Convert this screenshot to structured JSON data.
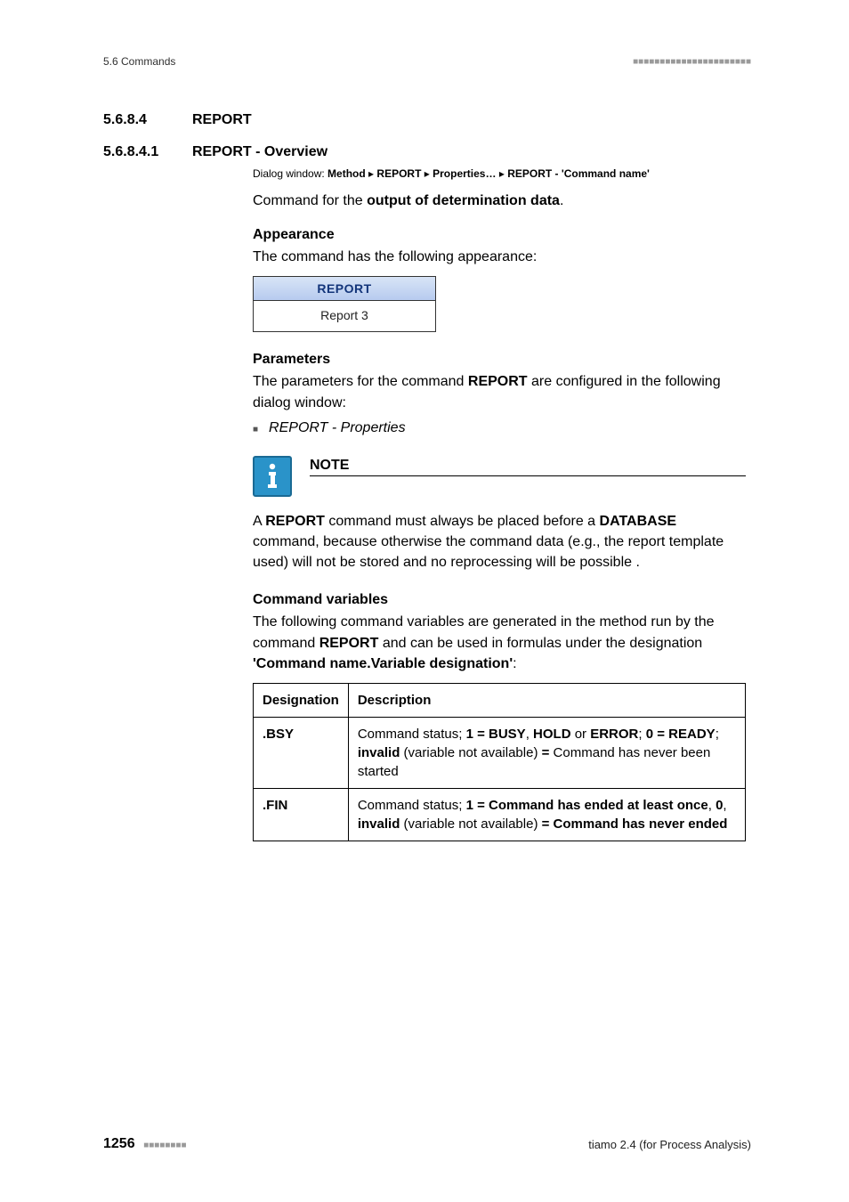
{
  "header": {
    "left": "5.6 Commands",
    "right_dashes": "■■■■■■■■■■■■■■■■■■■■■■"
  },
  "section1": {
    "num": "5.6.8.4",
    "title": "REPORT"
  },
  "section2": {
    "num": "5.6.8.4.1",
    "title": "REPORT - Overview"
  },
  "dialog": {
    "prefix": "Dialog window: ",
    "p1": "Method",
    "sep": " ▸ ",
    "p2": "REPORT",
    "p3": "Properties…",
    "p4": "REPORT - 'Command name'"
  },
  "intro": {
    "pre": "Command for the ",
    "bold": "output of determination data",
    "post": "."
  },
  "appearance": {
    "heading": "Appearance",
    "text": "The command has the following appearance:",
    "card_title": "REPORT",
    "card_body": "Report 3"
  },
  "parameters": {
    "heading": "Parameters",
    "text_pre": "The parameters for the command ",
    "text_bold": "REPORT",
    "text_post": " are configured in the following dialog window:",
    "item": "REPORT - Properties"
  },
  "note": {
    "title": "NOTE",
    "t1": "A ",
    "b1": "REPORT",
    "t2": " command must always be placed before a ",
    "b2": "DATABASE",
    "t3": " command, because otherwise the command data (e.g., the report template used) will not be stored and no reprocessing will be possible ."
  },
  "cmdvars": {
    "heading": "Command variables",
    "t1": "The following command variables are generated in the method run by the command ",
    "b1": "REPORT",
    "t2": " and can be used in formulas under the designation ",
    "b2": "'Command name.Variable designation'",
    "t3": ":"
  },
  "table": {
    "h1": "Designation",
    "h2": "Description",
    "rows": [
      {
        "d": ".BSY",
        "parts": {
          "a": "Command status; ",
          "b1": "1 = BUSY",
          "c1": ", ",
          "b2": "HOLD",
          "c2": " or ",
          "b3": "ERROR",
          "c3": "; ",
          "b4": "0 = READY",
          "c4": "; ",
          "b5": "invalid",
          "c5": " (variable not available) ",
          "b6": "=",
          "c6": " Command has never been started"
        }
      },
      {
        "d": ".FIN",
        "parts": {
          "a": "Command status; ",
          "b1": "1 = Command has ended at least once",
          "c1": ", ",
          "b2": "0",
          "c2": ", ",
          "b3": "invalid",
          "c3": " (variable not available) ",
          "b4": "= Command has never ended",
          "c4": "",
          "b5": "",
          "c5": "",
          "b6": "",
          "c6": ""
        }
      }
    ]
  },
  "footer": {
    "page": "1256",
    "dashes": "■■■■■■■■",
    "product": "tiamo 2.4 (for Process Analysis)"
  }
}
